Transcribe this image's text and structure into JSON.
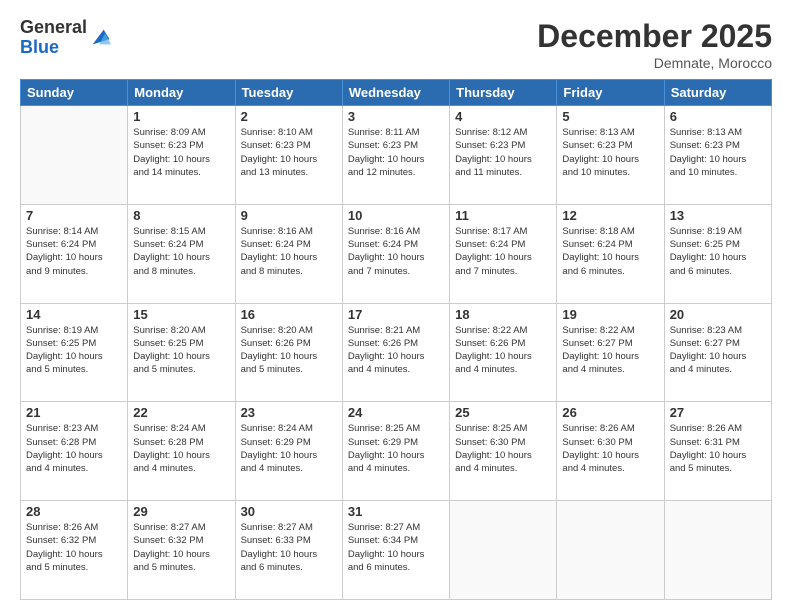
{
  "logo": {
    "general": "General",
    "blue": "Blue"
  },
  "header": {
    "month": "December 2025",
    "location": "Demnate, Morocco"
  },
  "weekdays": [
    "Sunday",
    "Monday",
    "Tuesday",
    "Wednesday",
    "Thursday",
    "Friday",
    "Saturday"
  ],
  "weeks": [
    [
      {
        "day": "",
        "info": ""
      },
      {
        "day": "1",
        "info": "Sunrise: 8:09 AM\nSunset: 6:23 PM\nDaylight: 10 hours\nand 14 minutes."
      },
      {
        "day": "2",
        "info": "Sunrise: 8:10 AM\nSunset: 6:23 PM\nDaylight: 10 hours\nand 13 minutes."
      },
      {
        "day": "3",
        "info": "Sunrise: 8:11 AM\nSunset: 6:23 PM\nDaylight: 10 hours\nand 12 minutes."
      },
      {
        "day": "4",
        "info": "Sunrise: 8:12 AM\nSunset: 6:23 PM\nDaylight: 10 hours\nand 11 minutes."
      },
      {
        "day": "5",
        "info": "Sunrise: 8:13 AM\nSunset: 6:23 PM\nDaylight: 10 hours\nand 10 minutes."
      },
      {
        "day": "6",
        "info": "Sunrise: 8:13 AM\nSunset: 6:23 PM\nDaylight: 10 hours\nand 10 minutes."
      }
    ],
    [
      {
        "day": "7",
        "info": "Sunrise: 8:14 AM\nSunset: 6:24 PM\nDaylight: 10 hours\nand 9 minutes."
      },
      {
        "day": "8",
        "info": "Sunrise: 8:15 AM\nSunset: 6:24 PM\nDaylight: 10 hours\nand 8 minutes."
      },
      {
        "day": "9",
        "info": "Sunrise: 8:16 AM\nSunset: 6:24 PM\nDaylight: 10 hours\nand 8 minutes."
      },
      {
        "day": "10",
        "info": "Sunrise: 8:16 AM\nSunset: 6:24 PM\nDaylight: 10 hours\nand 7 minutes."
      },
      {
        "day": "11",
        "info": "Sunrise: 8:17 AM\nSunset: 6:24 PM\nDaylight: 10 hours\nand 7 minutes."
      },
      {
        "day": "12",
        "info": "Sunrise: 8:18 AM\nSunset: 6:24 PM\nDaylight: 10 hours\nand 6 minutes."
      },
      {
        "day": "13",
        "info": "Sunrise: 8:19 AM\nSunset: 6:25 PM\nDaylight: 10 hours\nand 6 minutes."
      }
    ],
    [
      {
        "day": "14",
        "info": "Sunrise: 8:19 AM\nSunset: 6:25 PM\nDaylight: 10 hours\nand 5 minutes."
      },
      {
        "day": "15",
        "info": "Sunrise: 8:20 AM\nSunset: 6:25 PM\nDaylight: 10 hours\nand 5 minutes."
      },
      {
        "day": "16",
        "info": "Sunrise: 8:20 AM\nSunset: 6:26 PM\nDaylight: 10 hours\nand 5 minutes."
      },
      {
        "day": "17",
        "info": "Sunrise: 8:21 AM\nSunset: 6:26 PM\nDaylight: 10 hours\nand 4 minutes."
      },
      {
        "day": "18",
        "info": "Sunrise: 8:22 AM\nSunset: 6:26 PM\nDaylight: 10 hours\nand 4 minutes."
      },
      {
        "day": "19",
        "info": "Sunrise: 8:22 AM\nSunset: 6:27 PM\nDaylight: 10 hours\nand 4 minutes."
      },
      {
        "day": "20",
        "info": "Sunrise: 8:23 AM\nSunset: 6:27 PM\nDaylight: 10 hours\nand 4 minutes."
      }
    ],
    [
      {
        "day": "21",
        "info": "Sunrise: 8:23 AM\nSunset: 6:28 PM\nDaylight: 10 hours\nand 4 minutes."
      },
      {
        "day": "22",
        "info": "Sunrise: 8:24 AM\nSunset: 6:28 PM\nDaylight: 10 hours\nand 4 minutes."
      },
      {
        "day": "23",
        "info": "Sunrise: 8:24 AM\nSunset: 6:29 PM\nDaylight: 10 hours\nand 4 minutes."
      },
      {
        "day": "24",
        "info": "Sunrise: 8:25 AM\nSunset: 6:29 PM\nDaylight: 10 hours\nand 4 minutes."
      },
      {
        "day": "25",
        "info": "Sunrise: 8:25 AM\nSunset: 6:30 PM\nDaylight: 10 hours\nand 4 minutes."
      },
      {
        "day": "26",
        "info": "Sunrise: 8:26 AM\nSunset: 6:30 PM\nDaylight: 10 hours\nand 4 minutes."
      },
      {
        "day": "27",
        "info": "Sunrise: 8:26 AM\nSunset: 6:31 PM\nDaylight: 10 hours\nand 5 minutes."
      }
    ],
    [
      {
        "day": "28",
        "info": "Sunrise: 8:26 AM\nSunset: 6:32 PM\nDaylight: 10 hours\nand 5 minutes."
      },
      {
        "day": "29",
        "info": "Sunrise: 8:27 AM\nSunset: 6:32 PM\nDaylight: 10 hours\nand 5 minutes."
      },
      {
        "day": "30",
        "info": "Sunrise: 8:27 AM\nSunset: 6:33 PM\nDaylight: 10 hours\nand 6 minutes."
      },
      {
        "day": "31",
        "info": "Sunrise: 8:27 AM\nSunset: 6:34 PM\nDaylight: 10 hours\nand 6 minutes."
      },
      {
        "day": "",
        "info": ""
      },
      {
        "day": "",
        "info": ""
      },
      {
        "day": "",
        "info": ""
      }
    ]
  ]
}
